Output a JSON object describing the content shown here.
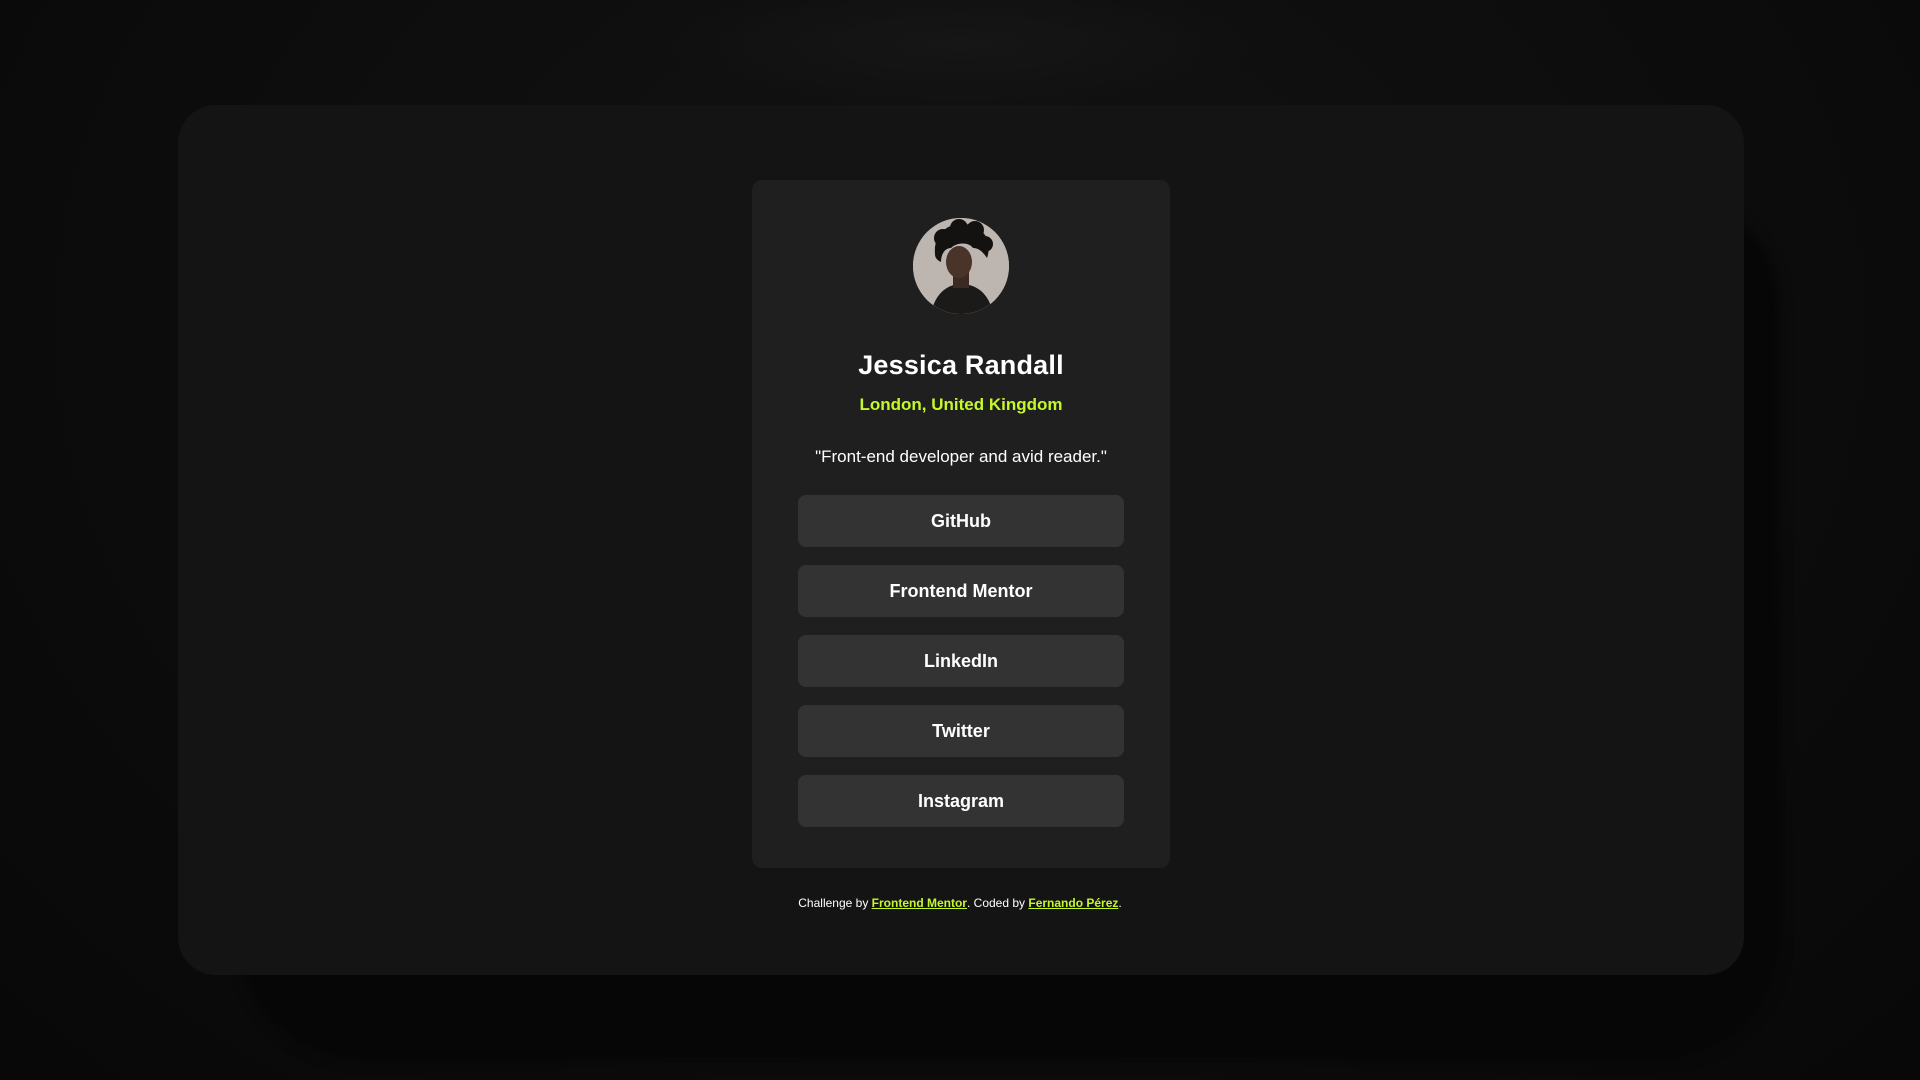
{
  "profile": {
    "avatar_icon": "profile-photo",
    "name": "Jessica Randall",
    "location": "London, United Kingdom",
    "bio": "\"Front-end developer and avid reader.\""
  },
  "links": [
    {
      "label": "GitHub"
    },
    {
      "label": "Frontend Mentor"
    },
    {
      "label": "LinkedIn"
    },
    {
      "label": "Twitter"
    },
    {
      "label": "Instagram"
    }
  ],
  "attribution": {
    "prefix": "Challenge by ",
    "challenge_link": "Frontend Mentor",
    "middle": ". Coded by ",
    "author_link": "Fernando Pérez",
    "suffix": "."
  },
  "colors": {
    "accent": "#c4f82a",
    "card_bg": "#1f1f1f",
    "button_bg": "#333333",
    "frame_bg": "#141414",
    "page_bg": "#0d0d0d"
  }
}
